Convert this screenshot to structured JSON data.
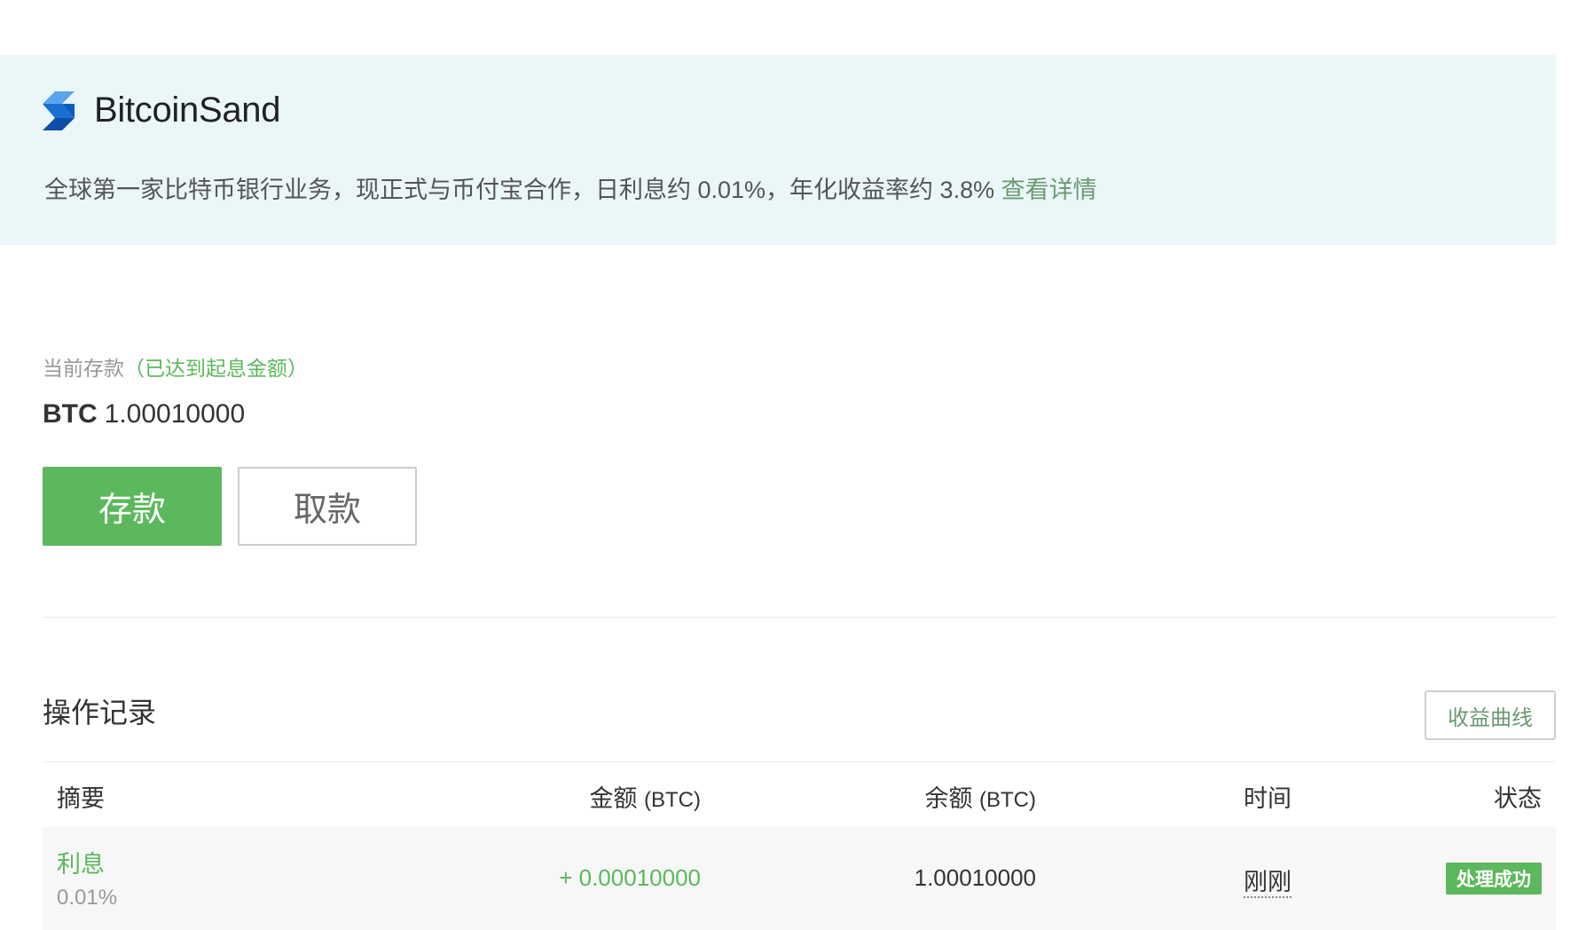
{
  "brand": {
    "name": "BitcoinSand",
    "logo_icon": "bitcoinsand-logo-icon",
    "logo_color": "#1a6fd1"
  },
  "banner": {
    "tagline": "全球第一家比特币银行业务，现正式与币付宝合作，日利息约 0.01%，年化收益率约 3.8% ",
    "details_link": "查看详情",
    "background": "#eaf6f8"
  },
  "deposit": {
    "label": "当前存款",
    "status": "（已达到起息金额）",
    "currency": "BTC",
    "amount": "1.00010000",
    "deposit_button": "存款",
    "withdraw_button": "取款"
  },
  "records": {
    "title": "操作记录",
    "curve_button": "收益曲线",
    "columns": {
      "summary": "摘要",
      "amount": "金额",
      "amount_unit": "(BTC)",
      "balance": "余额",
      "balance_unit": "(BTC)",
      "time": "时间",
      "status": "状态"
    },
    "rows": [
      {
        "type": "利息",
        "rate": "0.01%",
        "amount": "+ 0.00010000",
        "balance": "1.00010000",
        "time": "刚刚",
        "status": "处理成功"
      }
    ]
  },
  "colors": {
    "accent_green": "#5cb85c",
    "link_green": "#6a9a72"
  }
}
